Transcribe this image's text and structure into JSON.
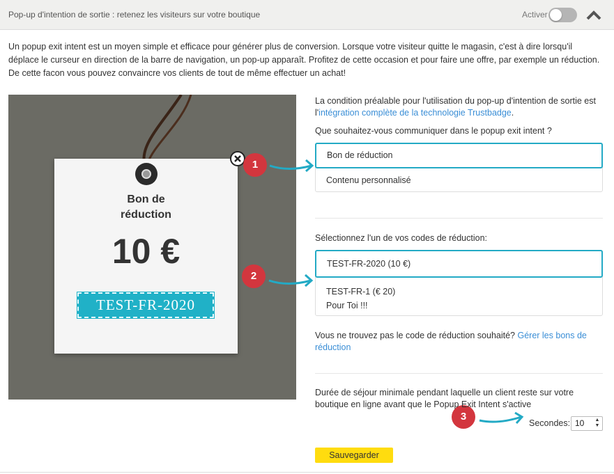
{
  "header": {
    "title": "Pop-up d'intention de sortie : retenez les visiteurs sur votre boutique",
    "toggle_label": "Activer",
    "toggle_on": false,
    "collapse_icon": "chevron-up-icon"
  },
  "intro": "Un popup exit intent est un moyen simple et efficace pour générer plus de conversion. Lorsque votre visiteur quitte le magasin, c'est à dire lorsqu'il déplace le curseur en direction de la barre de navigation, un pop-up apparaît. Profitez de cette occasion et pour faire une offre, par exemple un réduction. De cette facon vous pouvez convaincre vos clients de tout de même effectuer un achat!",
  "preview": {
    "tag_title_line1": "Bon de",
    "tag_title_line2": "réduction",
    "amount": "10 €",
    "code": "TEST-FR-2020",
    "close_icon": "close-icon"
  },
  "badges": [
    "1",
    "2",
    "3"
  ],
  "prerequisite": {
    "text": "La condition préalable pour l'utilisation du pop-up d'intention de sortie est l'",
    "link": "intégration complète de la technologie Trustbadge",
    "suffix": "."
  },
  "communicate": {
    "question": "Que souhaitez-vous communiquer dans le popup exit intent ?",
    "options": [
      "Bon de réduction",
      "Contenu personnalisé"
    ],
    "selected": 0
  },
  "codes": {
    "label": "Sélectionnez l'un de vos codes de réduction:",
    "options": [
      {
        "line1": "TEST-FR-2020 (10 €)"
      },
      {
        "line1": "TEST-FR-1 (€ 20)",
        "line2": "Pour Toi !!!"
      }
    ],
    "selected": 0
  },
  "not_found": {
    "text": "Vous ne trouvez pas le code de réduction souhaité? ",
    "link": "Gérer les bons de réduction"
  },
  "duration": {
    "text": "Durée de séjour minimale pendant laquelle un client reste sur votre boutique en ligne avant que le Popup Exit Intent s'active",
    "seconds_label": "Secondes:",
    "seconds_value": "10"
  },
  "save_label": "Sauvegarder",
  "colors": {
    "accent": "#23aac5",
    "badge": "#d3363e",
    "save": "#ffdc0f",
    "link": "#3a8ed6",
    "preview_bg": "#6b6b64"
  }
}
